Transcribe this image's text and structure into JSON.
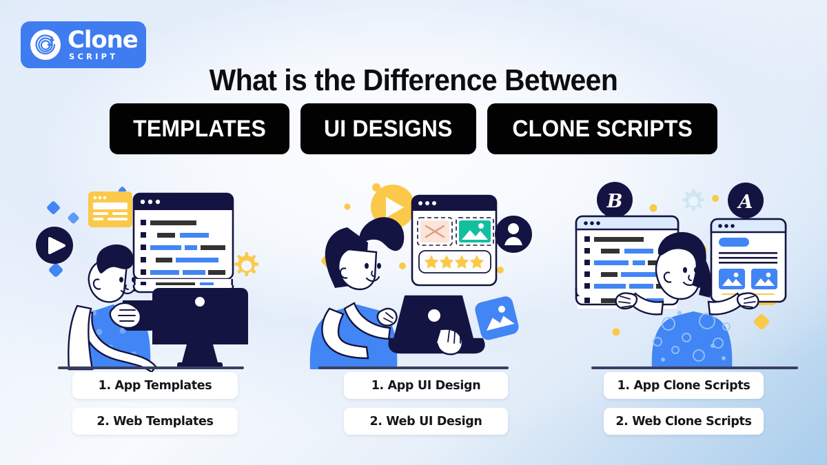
{
  "brand": {
    "name": "Clone",
    "tagline": "SCRIPT",
    "logo_icon": "clone-spiral-icon",
    "bg_color": "#3f7cf0",
    "text_color": "#ffffff"
  },
  "header": {
    "title": "What is the Difference Between",
    "pills": [
      {
        "label": "TEMPLATES"
      },
      {
        "label": "UI DESIGNS"
      },
      {
        "label": "CLONE SCRIPTS"
      }
    ],
    "pill_bg": "#020203",
    "pill_text": "#ffffff",
    "title_color": "#0d0d10"
  },
  "panels": [
    {
      "id": "templates",
      "illustration": "man-with-coffee-and-code-window",
      "captions": [
        {
          "label": "1. App Templates"
        },
        {
          "label": "2. Web Templates"
        }
      ],
      "decor_icons": [
        "play-button-icon",
        "gear-icon",
        "diamond-icon",
        "yellow-card-icon",
        "code-window-icon",
        "desktop-monitor-icon"
      ]
    },
    {
      "id": "ui-designs",
      "illustration": "woman-with-laptop-and-design-window",
      "captions": [
        {
          "label": "1. App UI Design"
        },
        {
          "label": "2. Web UI Design"
        }
      ],
      "decor_icons": [
        "play-button-icon",
        "user-avatar-icon",
        "image-icon",
        "star-rating-icon",
        "design-window-icon",
        "laptop-icon"
      ]
    },
    {
      "id": "clone-scripts",
      "illustration": "woman-holding-two-windows",
      "captions": [
        {
          "label": "1. App Clone Scripts"
        },
        {
          "label": "2. Web Clone Scripts"
        }
      ],
      "badges": [
        {
          "label": "B"
        },
        {
          "label": "A"
        }
      ],
      "decor_icons": [
        "gear-icon",
        "dot-icon",
        "code-window-icon",
        "layout-window-icon"
      ]
    }
  ],
  "palette": {
    "blue": "#4285f4",
    "navy": "#141442",
    "yellow": "#fbc94a",
    "teal": "#12bfa0",
    "dark_bar": "#333333",
    "white": "#ffffff",
    "page_bg_light": "#fdfdff",
    "page_bg_blue": "#a9cdec"
  }
}
